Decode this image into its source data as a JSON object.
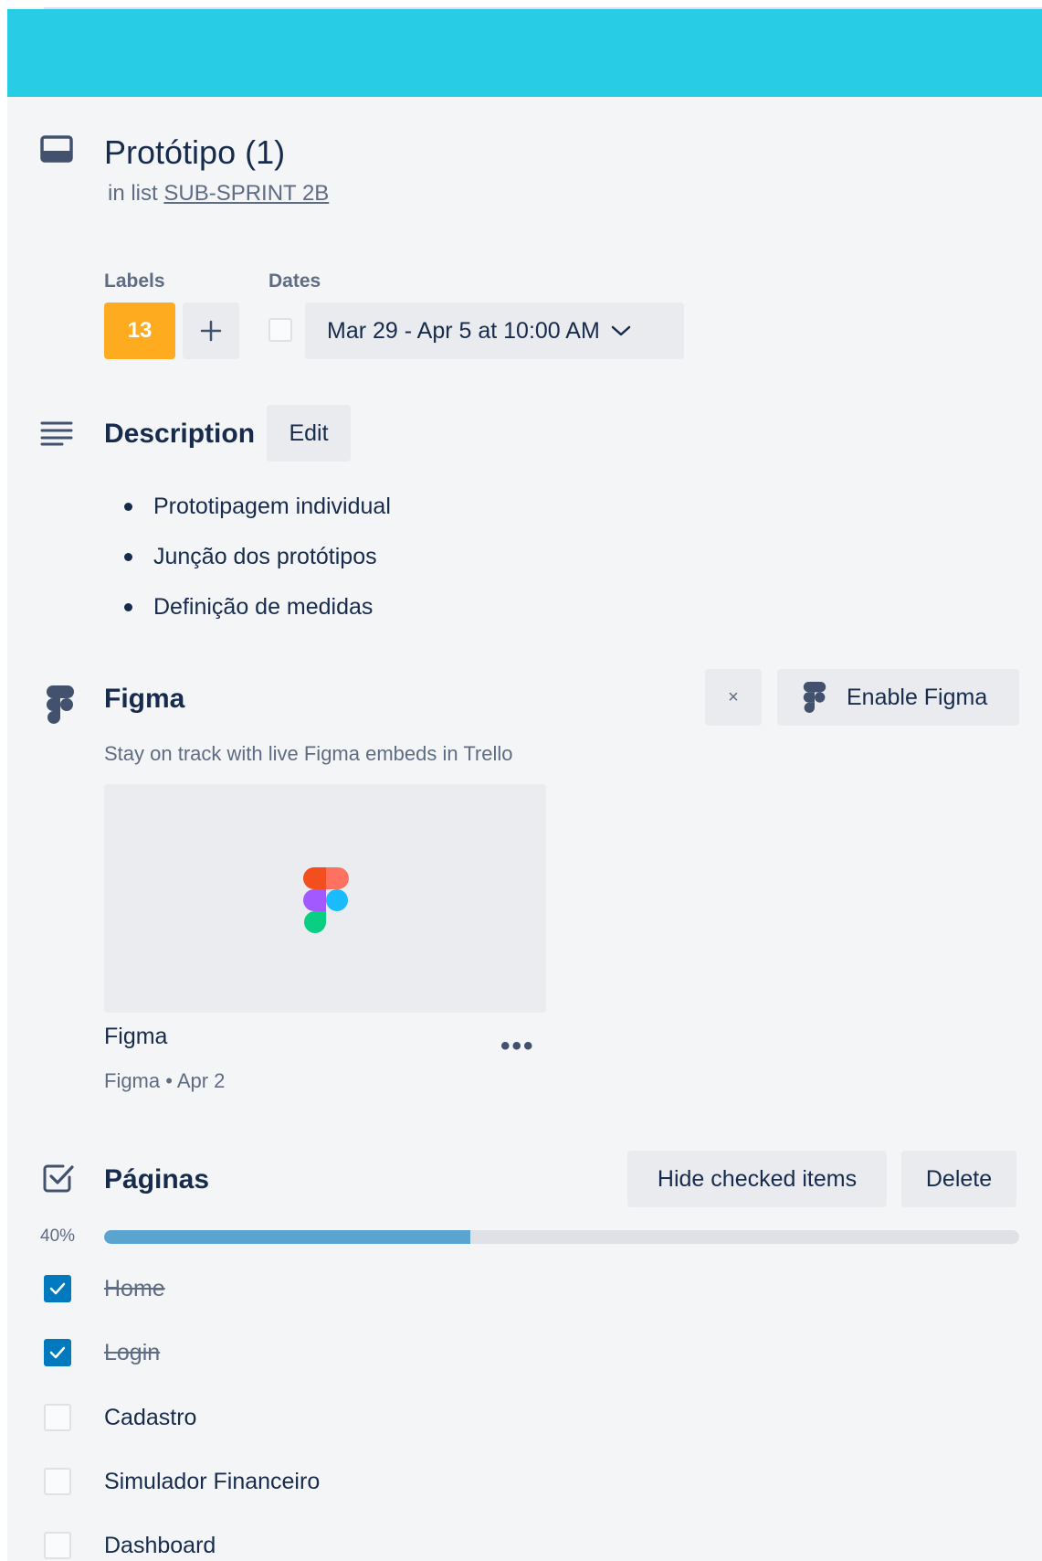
{
  "card": {
    "title": "Protótipo (1)",
    "in_list_prefix": "in list",
    "list_name": "SUB-SPRINT 2B"
  },
  "labels": {
    "heading": "Labels",
    "items": [
      {
        "text": "13",
        "color": "#ffab1f"
      }
    ]
  },
  "dates": {
    "heading": "Dates",
    "value": "Mar 29 - Apr 5 at 10:00 AM"
  },
  "description": {
    "title": "Description",
    "edit_label": "Edit",
    "bullets": [
      "Prototipagem individual",
      "Junção dos protótipos",
      "Definição de medidas"
    ]
  },
  "figma": {
    "title": "Figma",
    "close_label": "×",
    "enable_label": "Enable Figma",
    "subtitle": "Stay on track with live Figma embeds in Trello",
    "embed_name": "Figma",
    "embed_meta": "Figma • Apr 2"
  },
  "checklist": {
    "title": "Páginas",
    "hide_label": "Hide checked items",
    "delete_label": "Delete",
    "progress_text": "40%",
    "progress": 0.4,
    "items": [
      {
        "text": "Home",
        "checked": true
      },
      {
        "text": "Login",
        "checked": true
      },
      {
        "text": "Cadastro",
        "checked": false
      },
      {
        "text": "Simulador Financeiro",
        "checked": false
      },
      {
        "text": "Dashboard",
        "checked": false
      }
    ]
  },
  "colors": {
    "cover": "#29cce5",
    "accent_check": "#0079bf",
    "progress": "#5ba4cf"
  }
}
